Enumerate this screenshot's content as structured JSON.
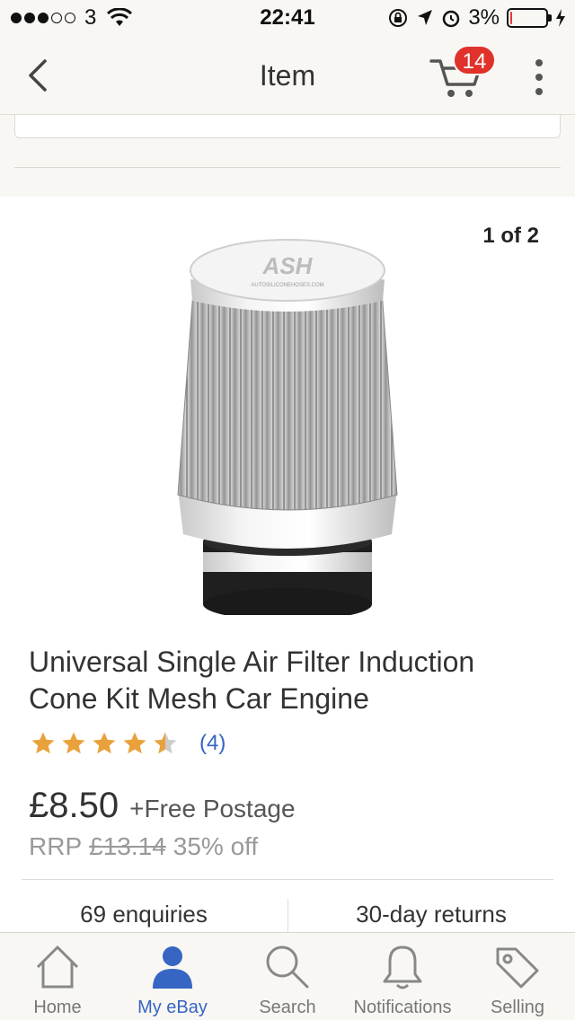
{
  "status_bar": {
    "carrier": "3",
    "time": "22:41",
    "battery": "3%",
    "signal_bars": [
      true,
      true,
      true,
      false,
      false
    ],
    "battery_level": 0.03
  },
  "nav": {
    "title": "Item",
    "cart_count": "14"
  },
  "gallery": {
    "pager": "1 of 2"
  },
  "product": {
    "title": "Universal Single Air Filter Induction Cone Kit Mesh Car Engine",
    "rating": 4.5,
    "review_count": "(4)",
    "price": "£8.50",
    "postage": "+Free Postage",
    "rrp_label": "RRP",
    "rrp_price": "£13.14",
    "discount": "35% off",
    "enquiries": "69 enquiries",
    "returns": "30-day returns",
    "brand_logo": "ASH",
    "brand_url": "AUTOSILICONEHOSES.COM"
  },
  "tabbar": {
    "items": [
      {
        "label": "Home",
        "icon": "home-icon"
      },
      {
        "label": "My eBay",
        "icon": "person-icon"
      },
      {
        "label": "Search",
        "icon": "search-icon"
      },
      {
        "label": "Notifications",
        "icon": "bell-icon"
      },
      {
        "label": "Selling",
        "icon": "tag-icon"
      }
    ],
    "active_index": 1
  },
  "colors": {
    "accent_blue": "#3665c4",
    "badge_red": "#e0322a",
    "star_gold": "#e9a23b",
    "star_gray": "#cccccc"
  }
}
